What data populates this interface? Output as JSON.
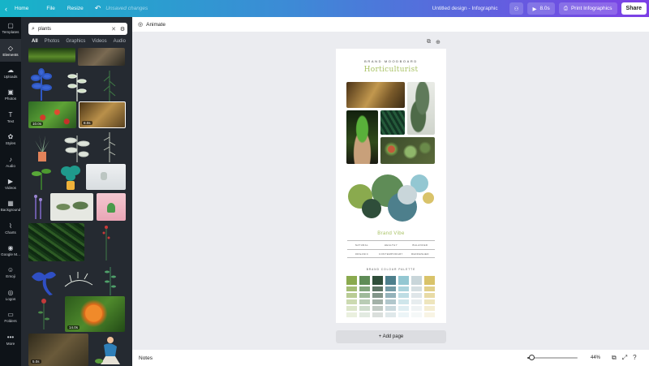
{
  "topbar": {
    "home": "Home",
    "file": "File",
    "resize": "Resize",
    "unsaved": "Unsaved changes",
    "design_title": "Untitled design - Infographic",
    "play_time": "8.0s",
    "print": "Print Infographics",
    "share": "Share"
  },
  "rail": [
    {
      "label": "Templates",
      "icon": "templates-icon",
      "glyph": "▢"
    },
    {
      "label": "Elements",
      "icon": "elements-icon",
      "glyph": "◇"
    },
    {
      "label": "Uploads",
      "icon": "uploads-icon",
      "glyph": "☁"
    },
    {
      "label": "Photos",
      "icon": "photos-icon",
      "glyph": "▣"
    },
    {
      "label": "Text",
      "icon": "text-icon",
      "glyph": "T"
    },
    {
      "label": "Styles",
      "icon": "styles-icon",
      "glyph": "✿"
    },
    {
      "label": "Audio",
      "icon": "audio-icon",
      "glyph": "♪"
    },
    {
      "label": "Videos",
      "icon": "videos-icon",
      "glyph": "▶"
    },
    {
      "label": "Background",
      "icon": "background-icon",
      "glyph": "▦"
    },
    {
      "label": "Charts",
      "icon": "charts-icon",
      "glyph": "⌇"
    },
    {
      "label": "Google M...",
      "icon": "google-maps-icon",
      "glyph": "◉"
    },
    {
      "label": "Emoji",
      "icon": "emoji-icon",
      "glyph": "☺"
    },
    {
      "label": "Logos",
      "icon": "logos-icon",
      "glyph": "◎"
    },
    {
      "label": "Folders",
      "icon": "folders-icon",
      "glyph": "▭"
    },
    {
      "label": "More",
      "icon": "more-icon",
      "glyph": "•••"
    }
  ],
  "panel": {
    "search_value": "plants",
    "tabs": [
      "All",
      "Photos",
      "Graphics",
      "Videos",
      "Audio"
    ],
    "durations": [
      "10.0s",
      "8.0s",
      "14.0s",
      "5.0s"
    ]
  },
  "animate": "Animate",
  "page": {
    "brand": "BRAND MOODBOARD",
    "title": "Horticulturist",
    "vibe_title": "Brand Vibe",
    "vibe": [
      [
        "NATURAL",
        "HEALTHY",
        "BALANCED"
      ],
      [
        "ORGANIC",
        "CONTEMPORARY",
        "REFRESHED"
      ]
    ],
    "palette_title": "BRAND COLOUR PALETTE"
  },
  "colors": {
    "palette": [
      "#8aaa4e",
      "#5f8c57",
      "#2f4e3a",
      "#4d7f8c",
      "#93c7d2",
      "#c9d6da",
      "#d9c36a"
    ],
    "circles": [
      "#8aaa4e",
      "#2f4e3a",
      "#5f8c57",
      "#4d7f8c",
      "#93c7d2",
      "#c9d6da",
      "#d9c36a"
    ]
  },
  "add_page": "+ Add page",
  "bottombar": {
    "notes": "Notes",
    "zoom": "44%",
    "zoom_percent": 44
  }
}
